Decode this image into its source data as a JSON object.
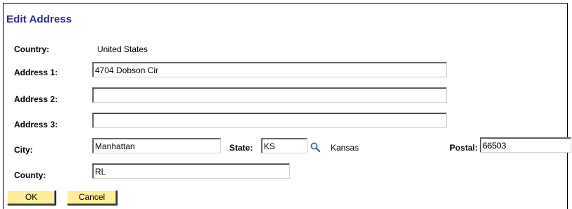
{
  "form": {
    "title": "Edit Address",
    "country": {
      "label": "Country:",
      "value": "United States"
    },
    "address1": {
      "label": "Address 1:",
      "value": "4704 Dobson Cir"
    },
    "address2": {
      "label": "Address 2:",
      "value": ""
    },
    "address3": {
      "label": "Address 3:",
      "value": ""
    },
    "city": {
      "label": "City:",
      "value": "Manhattan"
    },
    "state": {
      "label": "State:",
      "value": "KS",
      "description": "Kansas",
      "lookup_icon": "magnifier-icon"
    },
    "postal": {
      "label": "Postal:",
      "value": "66503"
    },
    "county": {
      "label": "County:",
      "value": "RL"
    }
  },
  "buttons": {
    "ok_label": "OK",
    "cancel_label": "Cancel",
    "background": "#ffee99"
  },
  "colors": {
    "title": "#2b2b8c"
  }
}
